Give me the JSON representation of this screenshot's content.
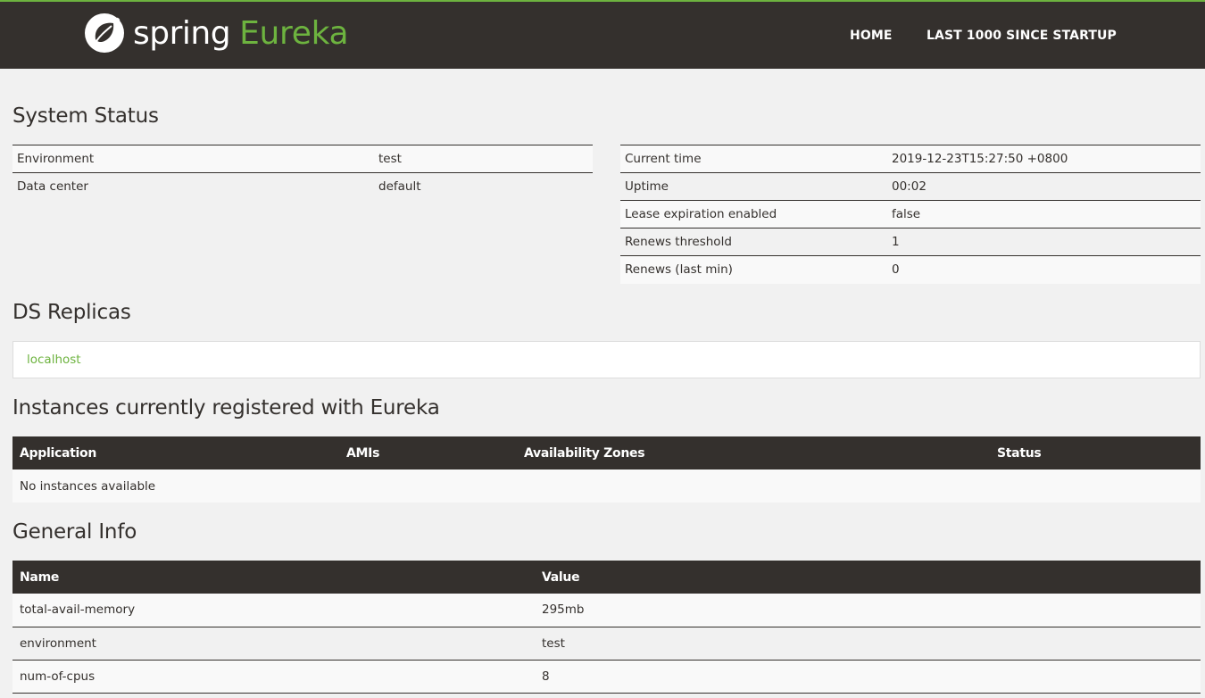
{
  "brand": {
    "spring": "spring",
    "eureka": "Eureka"
  },
  "nav": {
    "home": "HOME",
    "last1000": "LAST 1000 SINCE STARTUP"
  },
  "system_status": {
    "title": "System Status",
    "left": [
      {
        "label": "Environment",
        "value": "test"
      },
      {
        "label": "Data center",
        "value": "default"
      }
    ],
    "right": [
      {
        "label": "Current time",
        "value": "2019-12-23T15:27:50 +0800"
      },
      {
        "label": "Uptime",
        "value": "00:02"
      },
      {
        "label": "Lease expiration enabled",
        "value": "false"
      },
      {
        "label": "Renews threshold",
        "value": "1"
      },
      {
        "label": "Renews (last min)",
        "value": "0"
      }
    ]
  },
  "replicas": {
    "title": "DS Replicas",
    "items": [
      "localhost"
    ]
  },
  "instances": {
    "title": "Instances currently registered with Eureka",
    "columns": [
      "Application",
      "AMIs",
      "Availability Zones",
      "Status"
    ],
    "empty": "No instances available"
  },
  "general": {
    "title": "General Info",
    "columns": [
      "Name",
      "Value"
    ],
    "rows": [
      {
        "name": "total-avail-memory",
        "value": "295mb"
      },
      {
        "name": "environment",
        "value": "test"
      },
      {
        "name": "num-of-cpus",
        "value": "8"
      }
    ]
  },
  "colors": {
    "accent": "#6db33f",
    "dark": "#34302d",
    "background": "#f1f1f1"
  }
}
